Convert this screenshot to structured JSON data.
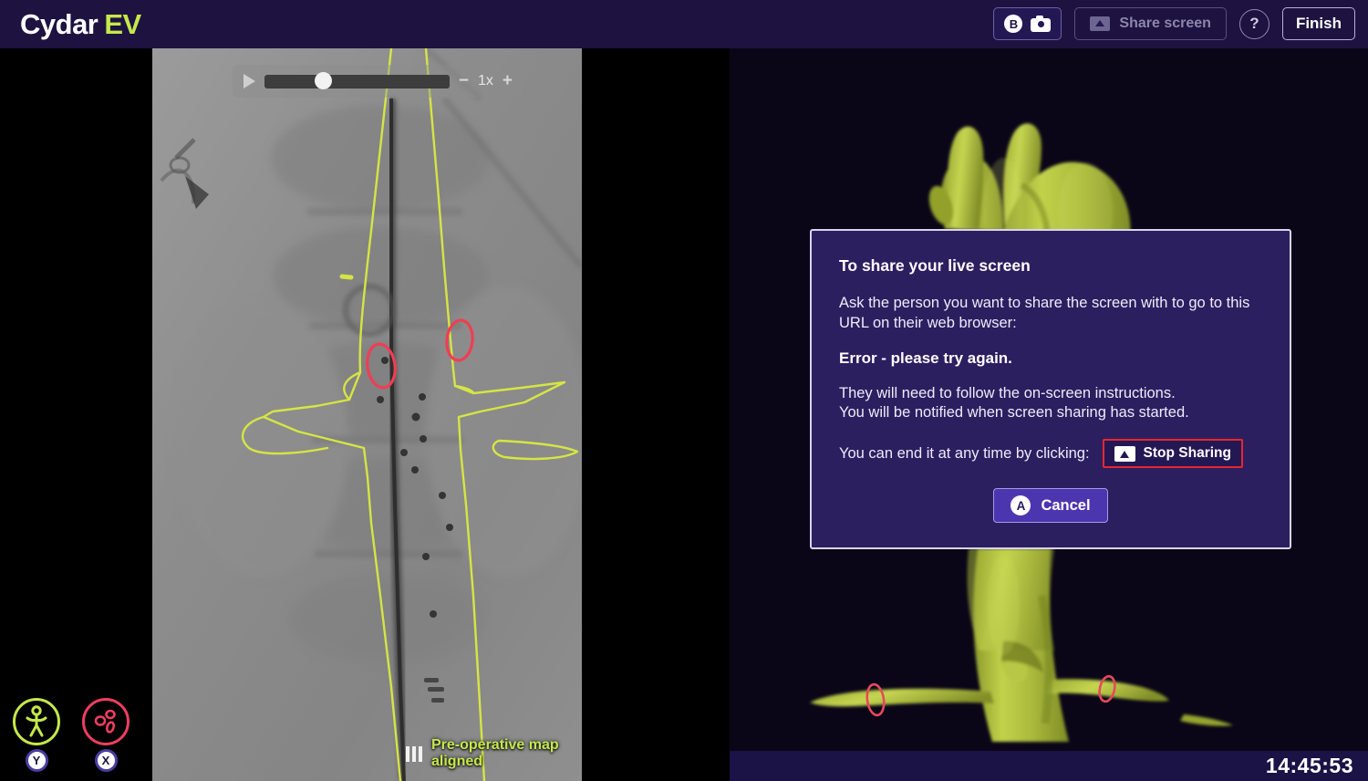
{
  "header": {
    "logo_primary": "Cydar",
    "logo_accent": "EV",
    "capture_badge": "B",
    "capture_icon": "camera-icon",
    "share_screen_label": "Share screen",
    "share_screen_icon": "share-screen-icon",
    "help_label": "?",
    "finish_label": "Finish",
    "bg_color": "#1d1240",
    "accent_color": "#c5e84b"
  },
  "playback": {
    "play_icon": "play-icon",
    "minus_label": "−",
    "speed_label": "1x",
    "plus_label": "+",
    "seek_position_pct": 19
  },
  "toggles": [
    {
      "name": "anatomy-overlay-toggle",
      "icon": "human-figure-icon",
      "key": "Y",
      "color": "#c5e84b",
      "state": "on"
    },
    {
      "name": "ostia-markers-toggle",
      "icon": "ostia-markers-icon",
      "key": "X",
      "color": "#ef3e60",
      "state": "on"
    }
  ],
  "status": {
    "icon": "alignment-bars-icon",
    "text": "Pre-operative map aligned",
    "color": "#c5e84b"
  },
  "viewer_3d": {
    "model": "aortic-vessel-3d-model",
    "model_color": "#b0bf38",
    "background": "#0a0618"
  },
  "clock": {
    "time": "14:45:53"
  },
  "dialog": {
    "title": "To share your live screen",
    "instruction": "Ask the person you want to share the screen with to go to this URL on their web browser:",
    "error": "Error - please try again.",
    "followup_line1": "They will need to follow the on-screen instructions.",
    "followup_line2": "You will be notified when screen sharing has started.",
    "end_prefix": "You can end it at any time by clicking:",
    "stop_sharing_label": "Stop Sharing",
    "stop_sharing_icon": "share-screen-icon",
    "cancel_badge": "A",
    "cancel_label": "Cancel",
    "border_color": "#d9d4ee",
    "bg_color": "#2b1f60",
    "stop_border_color": "#e8272f"
  }
}
